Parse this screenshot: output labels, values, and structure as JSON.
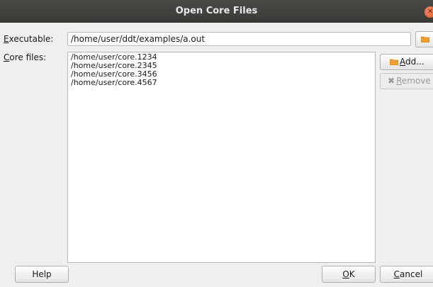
{
  "window": {
    "title": "Open Core Files",
    "close_icon": "close-icon",
    "accent_close": "#e95420"
  },
  "executable": {
    "label_first": "E",
    "label_rest": "xecutable:",
    "value": "/home/user/ddt/examples/a.out",
    "browse_icon": "folder-icon"
  },
  "core_files": {
    "label_first": "C",
    "label_rest": "ore files:",
    "items": [
      "/home/user/core.1234",
      "/home/user/core.2345",
      "/home/user/core.3456",
      "/home/user/core.4567"
    ]
  },
  "buttons": {
    "add_first": "A",
    "add_rest": "dd...",
    "remove_first": "R",
    "remove_rest": "emove",
    "help": "Help",
    "ok_first": "O",
    "ok_rest": "K",
    "cancel_first": "C",
    "cancel_rest": "ancel"
  },
  "colors": {
    "folder": "#f0a030",
    "titlebar": "#3f3e3a"
  }
}
